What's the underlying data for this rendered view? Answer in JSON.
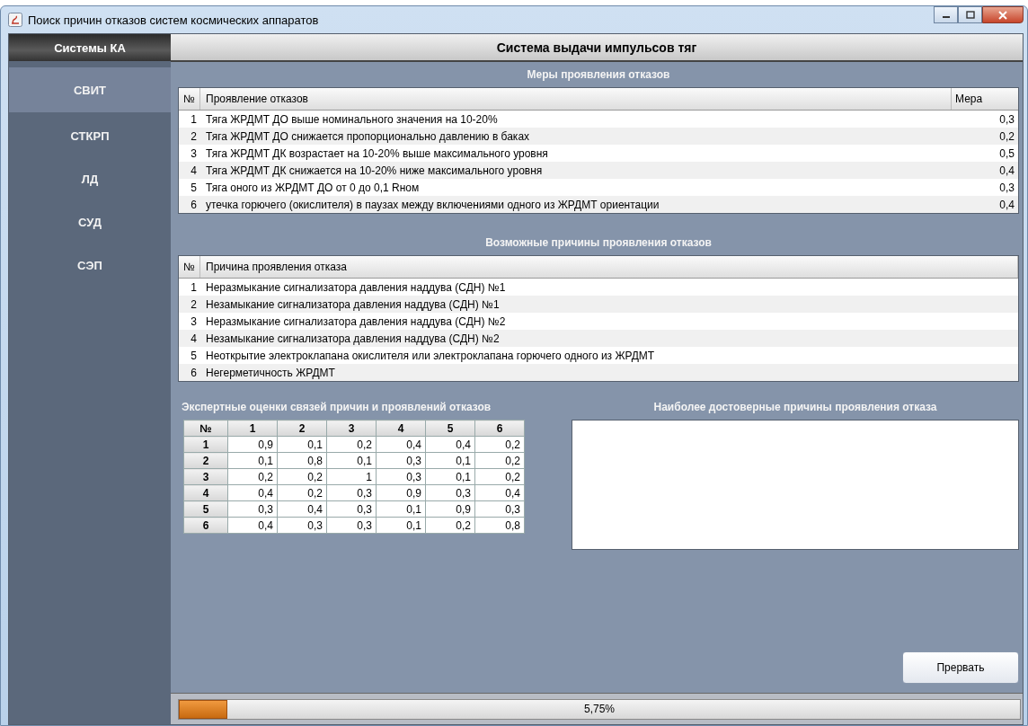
{
  "window": {
    "title": "Поиск причин отказов систем космических аппаратов"
  },
  "sidebar": {
    "title": "Системы КА",
    "items": [
      {
        "label": "СВИТ",
        "selected": true
      },
      {
        "label": "СТКРП",
        "selected": false
      },
      {
        "label": "ЛД",
        "selected": false
      },
      {
        "label": "СУД",
        "selected": false
      },
      {
        "label": "СЭП",
        "selected": false
      }
    ]
  },
  "header": "Система выдачи импульсов тяг",
  "measures": {
    "title": "Меры проявления отказов",
    "columns": [
      "№",
      "Проявление отказов",
      "Мера"
    ],
    "rows": [
      {
        "n": "1",
        "text": "Тяга ЖРДМТ ДО выше номинального значения на 10-20%",
        "measure": "0,3"
      },
      {
        "n": "2",
        "text": "Тяга ЖРДМТ ДО снижается пропорционально давлению в баках",
        "measure": "0,2"
      },
      {
        "n": "3",
        "text": "Тяга ЖРДМТ ДК возрастает на 10-20% выше максимального уровня",
        "measure": "0,5"
      },
      {
        "n": "4",
        "text": "Тяга ЖРДМТ ДК снижается на 10-20% ниже максимального уровня",
        "measure": "0,4"
      },
      {
        "n": "5",
        "text": "Тяга оного из ЖРДМТ ДО от 0 до 0,1 Rном",
        "measure": "0,3"
      },
      {
        "n": "6",
        "text": "утечка горючего (окислителя) в паузах между включениями одного из ЖРДМТ ориентации",
        "measure": "0,4"
      }
    ]
  },
  "causes": {
    "title": "Возможные причины проявления отказов",
    "columns": [
      "№",
      "Причина проявления отказа"
    ],
    "rows": [
      {
        "n": "1",
        "text": "Неразмыкание сигнализатора давления наддува (СДН) №1"
      },
      {
        "n": "2",
        "text": "Незамыкание сигнализатора давления наддува (СДН) №1"
      },
      {
        "n": "3",
        "text": "Неразмыкание сигнализатора давления наддува (СДН) №2"
      },
      {
        "n": "4",
        "text": "Незамыкание сигнализатора давления наддува (СДН) №2"
      },
      {
        "n": "5",
        "text": "Неоткрытие электроклапана окислителя или электроклапана горючего одного из ЖРДМТ"
      },
      {
        "n": "6",
        "text": "Негерметичность ЖРДМТ"
      }
    ]
  },
  "matrix": {
    "title": "Экспертные оценки связей причин и проявлений отказов",
    "columns": [
      "№",
      "1",
      "2",
      "3",
      "4",
      "5",
      "6"
    ],
    "rows": [
      {
        "label": "1",
        "values": [
          "0,9",
          "0,1",
          "0,2",
          "0,4",
          "0,4",
          "0,2"
        ]
      },
      {
        "label": "2",
        "values": [
          "0,1",
          "0,8",
          "0,1",
          "0,3",
          "0,1",
          "0,2"
        ]
      },
      {
        "label": "3",
        "values": [
          "0,2",
          "0,2",
          "1",
          "0,3",
          "0,1",
          "0,2"
        ]
      },
      {
        "label": "4",
        "values": [
          "0,4",
          "0,2",
          "0,3",
          "0,9",
          "0,3",
          "0,4"
        ]
      },
      {
        "label": "5",
        "values": [
          "0,3",
          "0,4",
          "0,3",
          "0,1",
          "0,9",
          "0,3"
        ]
      },
      {
        "label": "6",
        "values": [
          "0,4",
          "0,3",
          "0,3",
          "0,1",
          "0,2",
          "0,8"
        ]
      }
    ]
  },
  "results": {
    "title": "Наиболее достоверные причины проявления отказа"
  },
  "abort_button": "Прервать",
  "progress": {
    "level": 0.0575,
    "reading": "5,75%"
  }
}
